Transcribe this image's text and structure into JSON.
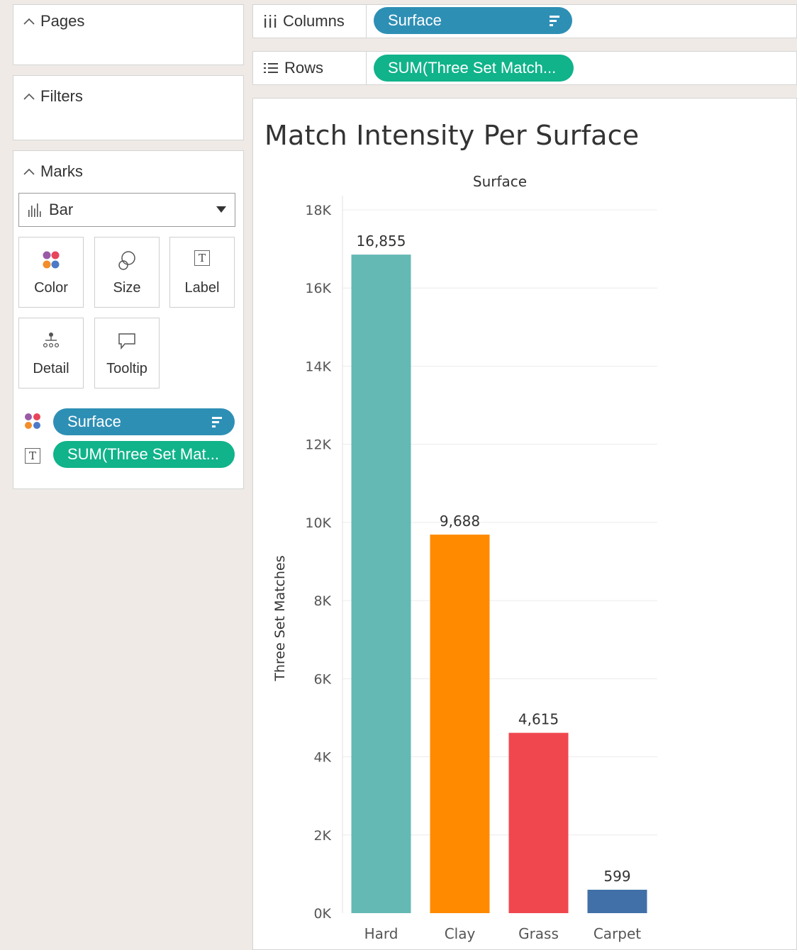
{
  "left_pane": {
    "pages_label": "Pages",
    "filters_label": "Filters",
    "marks": {
      "title": "Marks",
      "mark_type": "Bar",
      "cards": [
        {
          "label": "Color",
          "icon": "color-palette-icon"
        },
        {
          "label": "Size",
          "icon": "size-circles-icon"
        },
        {
          "label": "Label",
          "icon": "text-label-icon"
        },
        {
          "label": "Detail",
          "icon": "detail-dots-icon"
        },
        {
          "label": "Tooltip",
          "icon": "tooltip-speech-icon"
        }
      ],
      "fields": [
        {
          "name": "Surface",
          "role": "color"
        },
        {
          "name": "SUM(Three Set Mat...",
          "role": "label"
        }
      ]
    }
  },
  "shelves": {
    "columns_label": "Columns",
    "columns_pill": "Surface",
    "rows_label": "Rows",
    "rows_pill": "SUM(Three Set Match..."
  },
  "colors": {
    "pill_dimension": "#2e8fb5",
    "pill_measure": "#10b38a"
  },
  "chart_data": {
    "type": "bar",
    "title": "Match Intensity Per Surface",
    "column_header": "Surface",
    "ylabel": "Three Set Matches",
    "categories": [
      "Hard",
      "Clay",
      "Grass",
      "Carpet"
    ],
    "values": [
      16855,
      9688,
      4615,
      599
    ],
    "value_labels": [
      "16,855",
      "9,688",
      "4,615",
      "599"
    ],
    "colors": [
      "#64b9b4",
      "#ff8a00",
      "#f0474f",
      "#4170a8"
    ],
    "ylim": [
      0,
      18000
    ],
    "yticks": [
      0,
      2000,
      4000,
      6000,
      8000,
      10000,
      12000,
      14000,
      16000,
      18000
    ],
    "ytick_labels": [
      "0K",
      "2K",
      "4K",
      "6K",
      "8K",
      "10K",
      "12K",
      "14K",
      "16K",
      "18K"
    ],
    "grid": true
  }
}
